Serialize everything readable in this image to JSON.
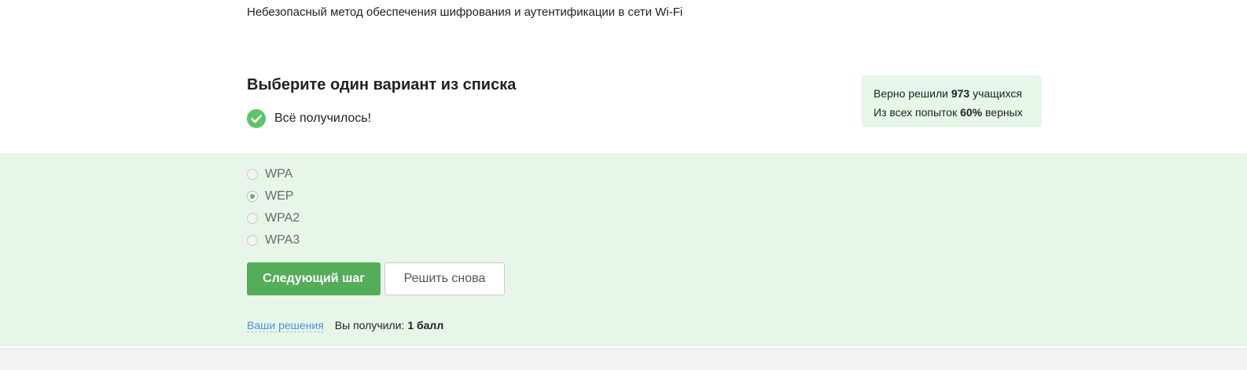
{
  "question": {
    "text": "Небезопасный метод обеспечения шифрования и аутентификации в сети Wi-Fi"
  },
  "task": {
    "heading": "Выберите один вариант из списка",
    "result_text": "Всё получилось!",
    "result_icon": "check-circle-icon"
  },
  "stats": {
    "line1_prefix": "Верно решили",
    "line1_count": "973",
    "line1_suffix": "учащихся",
    "line2_prefix": "Из всех попыток",
    "line2_percent": "60%",
    "line2_suffix": "верных"
  },
  "options": [
    {
      "label": "WPA",
      "selected": false
    },
    {
      "label": "WEP",
      "selected": true
    },
    {
      "label": "WPA2",
      "selected": false
    },
    {
      "label": "WPA3",
      "selected": false
    }
  ],
  "actions": {
    "next_label": "Следующий шаг",
    "retry_label": "Решить снова"
  },
  "footer": {
    "solutions_link": "Ваши решения",
    "score_label": "Вы получили:",
    "score_value": "1 балл"
  },
  "colors": {
    "accent_green": "#54ad58",
    "success_bg": "#e8f6e9",
    "link_blue": "#4a90d9"
  }
}
